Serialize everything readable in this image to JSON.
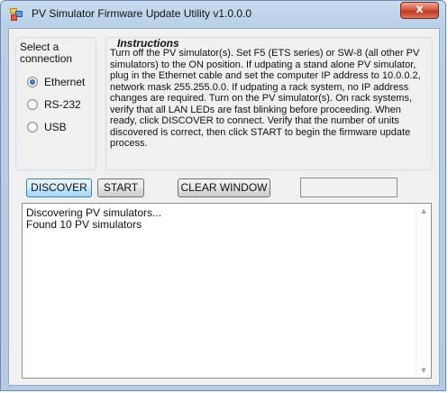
{
  "window": {
    "title": "PV Simulator Firmware Update Utility v1.0.0.0",
    "close_glyph": "x",
    "app_icon": "app-window-icon"
  },
  "connection": {
    "group_title": "Select a connection",
    "options": [
      {
        "label": "Ethernet",
        "checked": true
      },
      {
        "label": "RS-232",
        "checked": false
      },
      {
        "label": "USB",
        "checked": false
      }
    ]
  },
  "instructions": {
    "title": "Instructions",
    "body": "Turn off the PV simulator(s). Set F5 (ETS series) or SW-8 (all other PV simulators) to the ON position. If udpating a stand alone PV simulator, plug in the Ethernet cable and set the computer IP address to 10.0.0.2, network mask 255.255.0.0. If udpating a rack system, no IP address changes are required. Turn on the PV simulator(s). On rack systems, verify that all LAN LEDs are fast blinking before proceeding. When ready, click DISCOVER to connect. Verify that the number of units discovered is correct, then click START to begin the firmware update process."
  },
  "toolbar": {
    "discover_label": "DISCOVER",
    "start_label": "START",
    "clear_label": "CLEAR WINDOW",
    "status_value": ""
  },
  "log": {
    "lines": [
      "Discovering PV simulators...",
      "Found 10 PV simulators"
    ]
  },
  "scrollbar": {
    "up_glyph": "▲",
    "down_glyph": "▼"
  },
  "colors": {
    "title_bar": "#b8cfe8",
    "close_button": "#c0391f",
    "focus_border": "#3c7fb1"
  }
}
